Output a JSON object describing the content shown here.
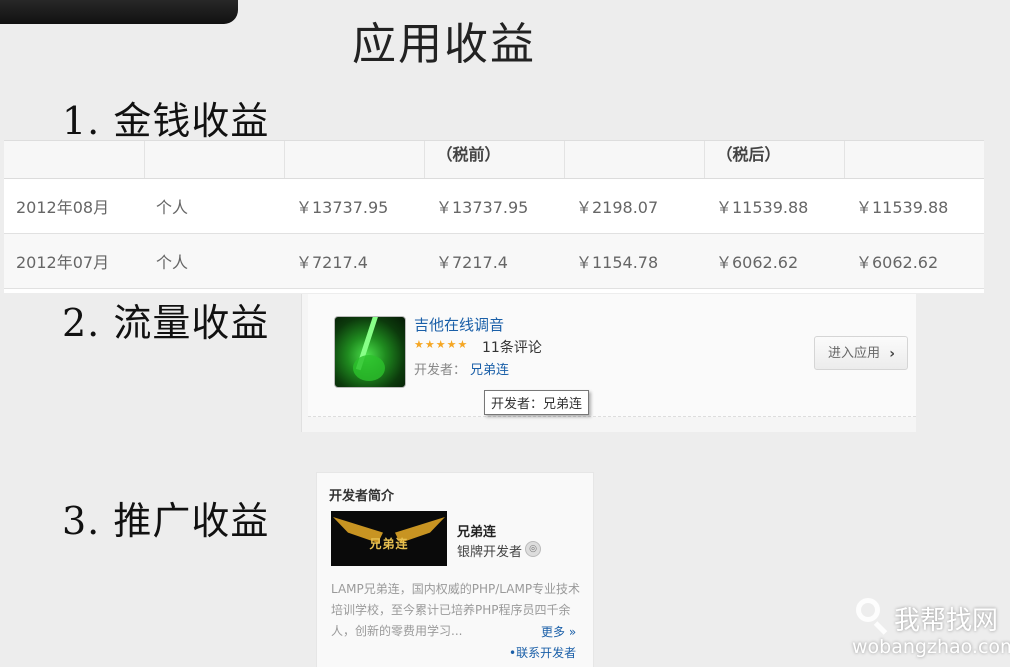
{
  "slide": {
    "title": "应用收益"
  },
  "sections": [
    {
      "heading": "1. 金钱收益"
    },
    {
      "heading": "2. 流量收益"
    },
    {
      "heading": "3. 推广收益"
    }
  ],
  "income_table": {
    "headers": [
      "",
      "",
      "",
      "（税前）",
      "",
      "（税后）",
      ""
    ],
    "rows": [
      [
        "2012年08月",
        "个人",
        "￥13737.95",
        "￥13737.95",
        "￥2198.07",
        "￥11539.88",
        "￥11539.88"
      ],
      [
        "2012年07月",
        "个人",
        "￥7217.4",
        "￥7217.4",
        "￥1154.78",
        "￥6062.62",
        "￥6062.62"
      ]
    ]
  },
  "app_card": {
    "name": "吉他在线调音",
    "rating": 4.5,
    "stars": "★★★★★",
    "reviews": "11条评论",
    "developer_label": "开发者：",
    "developer_name": "兄弟连",
    "tooltip": "开发者：兄弟连",
    "enter_button": "进入应用",
    "enter_chevron": "›"
  },
  "developer_profile": {
    "header": "开发者简介",
    "logo_text": "兄弟连",
    "name": "兄弟连",
    "level": "银牌开发者",
    "intro": "LAMP兄弟连，国内权威的PHP/LAMP专业技术培训学校，至今累计已培养PHP程序员四千余人，创新的零费用学习...",
    "more": "更多 »",
    "contact": "•联系开发者"
  },
  "watermark": {
    "cn": "我帮找网",
    "en": "wobangzhao.com"
  }
}
